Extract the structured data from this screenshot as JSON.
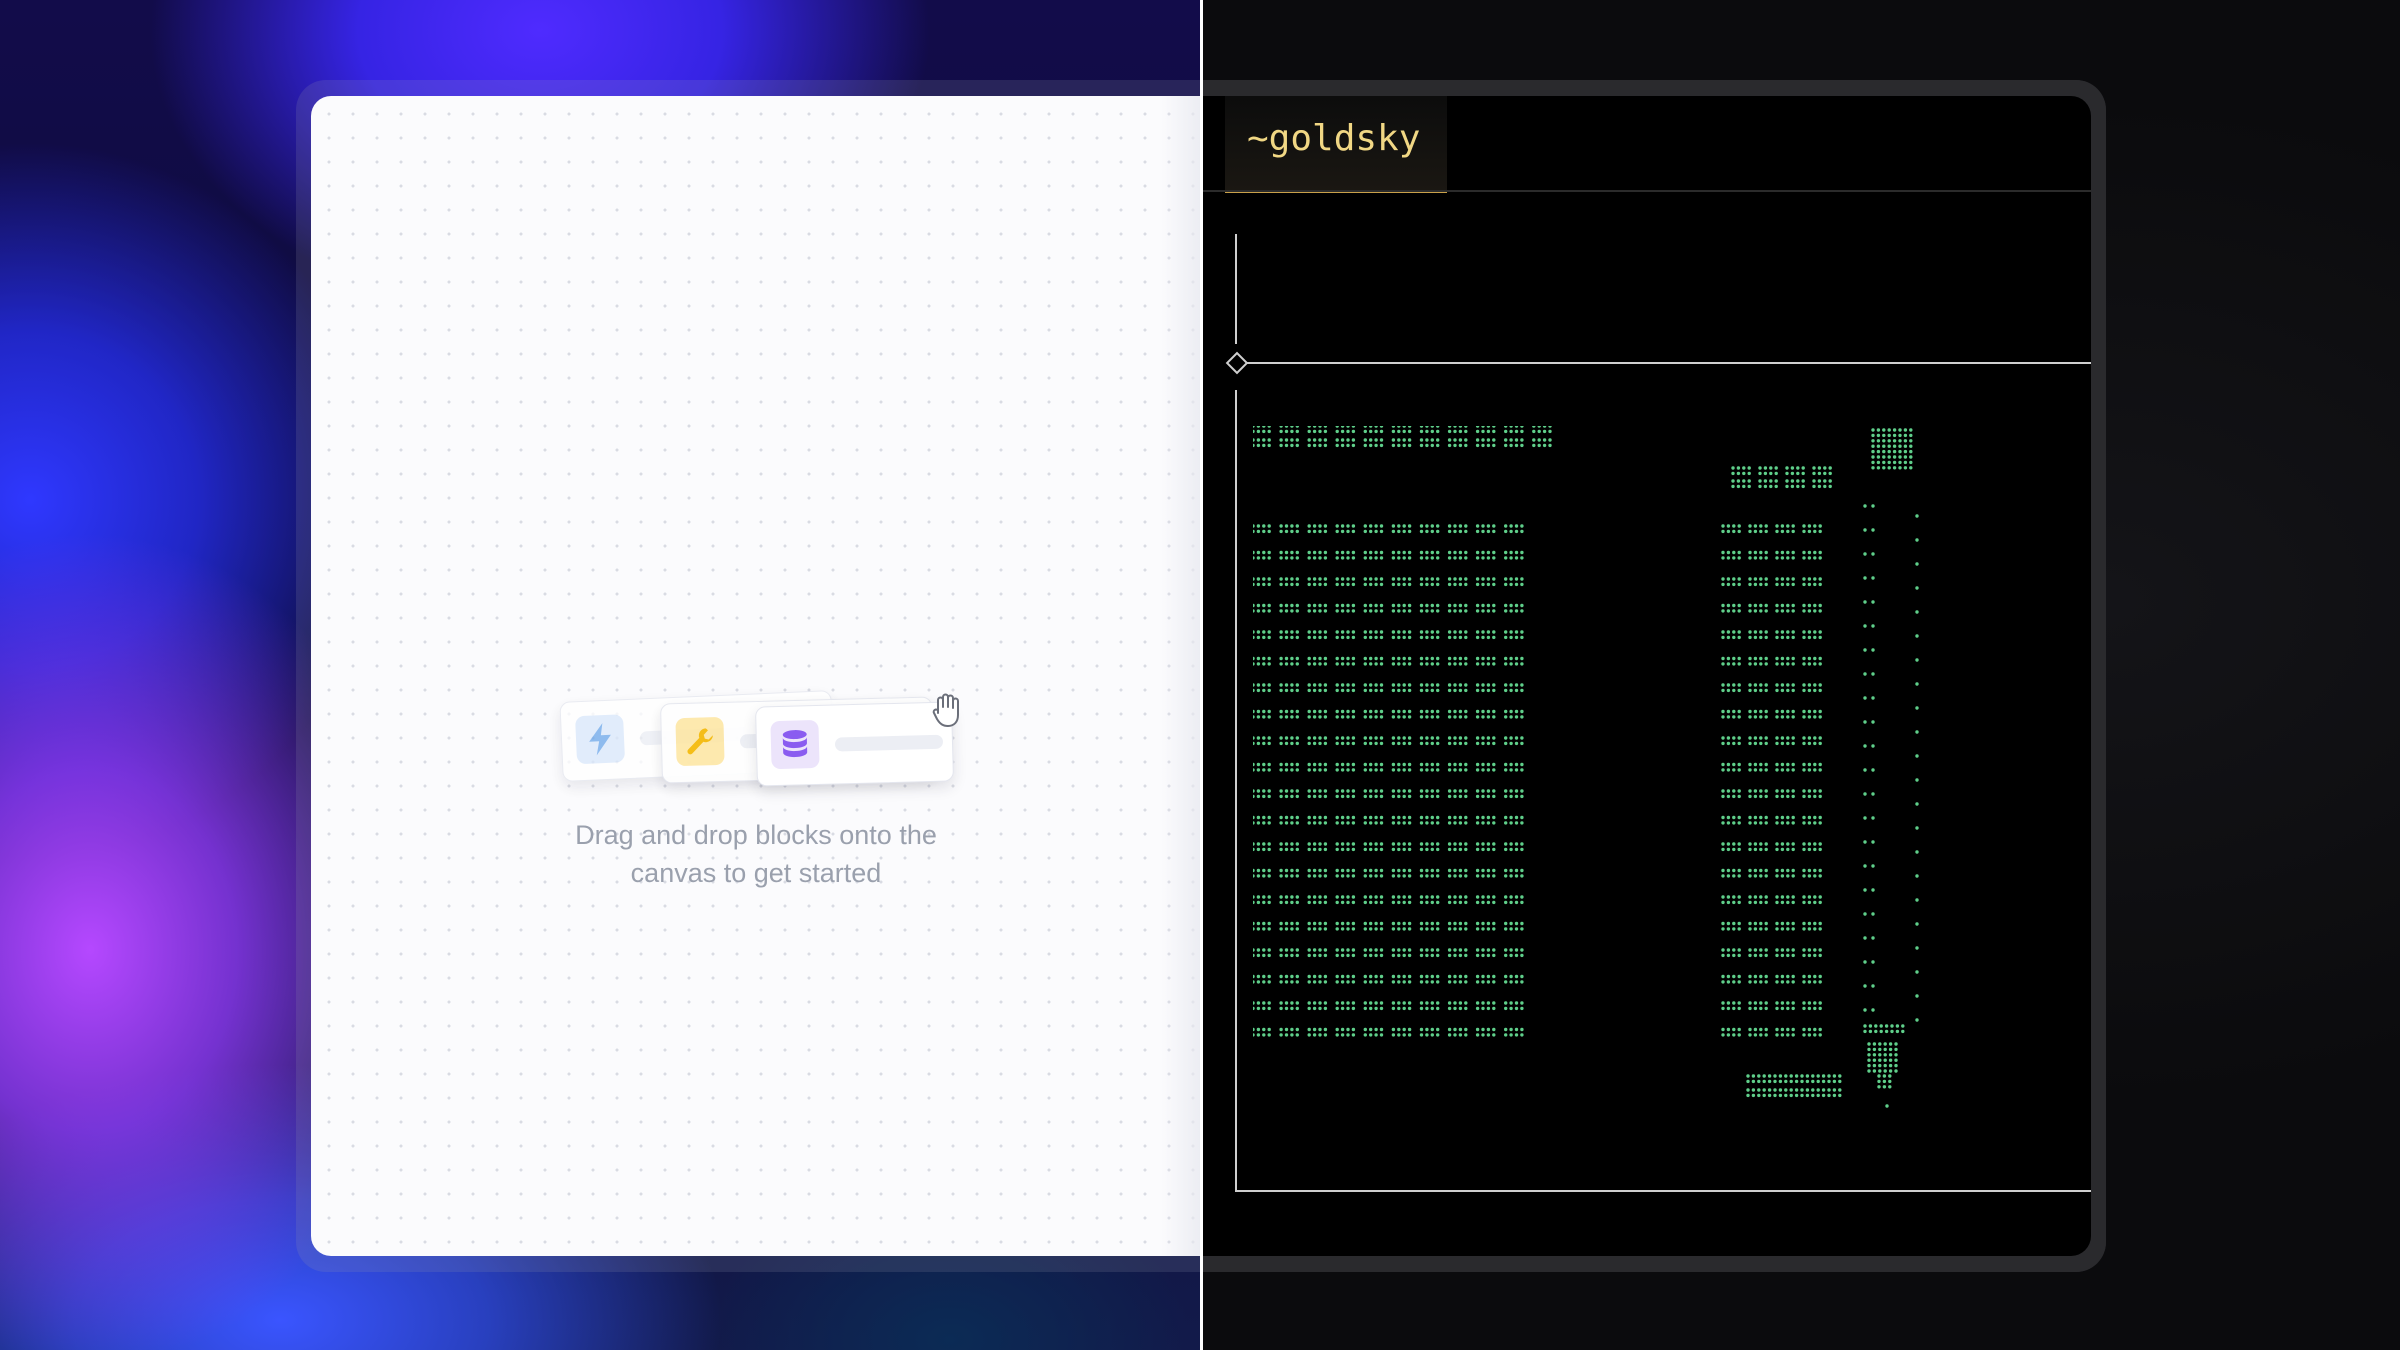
{
  "canvas": {
    "empty_message": "Drag and drop blocks onto the canvas to get started",
    "blocks": [
      {
        "icon": "lightning-bolt-icon",
        "color": "#6aa6ea"
      },
      {
        "icon": "wrench-icon",
        "color": "#f5b800"
      },
      {
        "icon": "database-icon",
        "color": "#8a5cf0"
      }
    ],
    "cursor_icon": "grab-hand-icon"
  },
  "terminal": {
    "tab_label": "~goldsky",
    "accent_color": "#c9a14a",
    "art_color": "#5fcf8a"
  }
}
